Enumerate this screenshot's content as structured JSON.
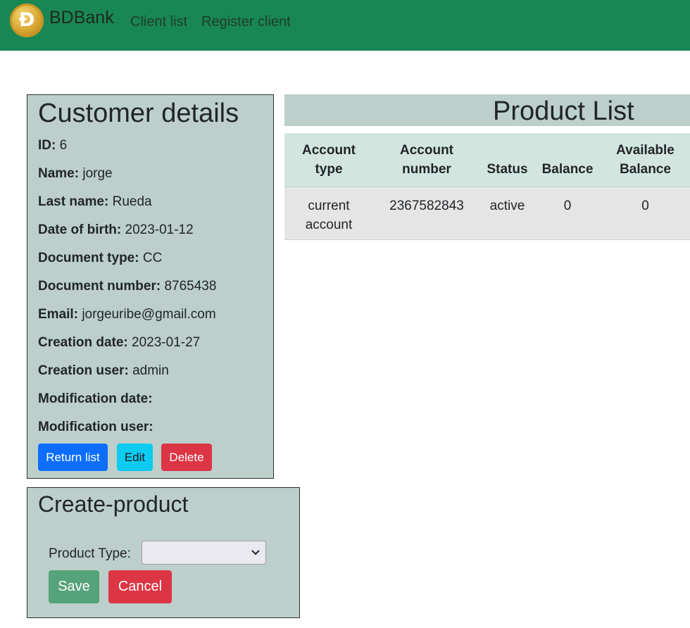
{
  "navbar": {
    "logo_glyph": "Đ",
    "brand": "BDBank",
    "links": [
      "Client list",
      "Register client"
    ],
    "bg_color": "#198754"
  },
  "customer_details": {
    "title": "Customer details",
    "fields": [
      {
        "label": "ID:",
        "value": "6"
      },
      {
        "label": "Name:",
        "value": "jorge"
      },
      {
        "label": "Last name:",
        "value": "Rueda"
      },
      {
        "label": "Date of birth:",
        "value": "2023-01-12"
      },
      {
        "label": "Document type:",
        "value": "CC"
      },
      {
        "label": "Document number:",
        "value": "8765438"
      },
      {
        "label": "Email:",
        "value": "jorgeuribe@gmail.com"
      },
      {
        "label": "Creation date:",
        "value": "2023-01-27"
      },
      {
        "label": "Creation user:",
        "value": "admin"
      },
      {
        "label": "Modification date:",
        "value": ""
      },
      {
        "label": "Modification user:",
        "value": ""
      }
    ],
    "buttons": {
      "return": "Return list",
      "edit": "Edit",
      "delete": "Delete"
    }
  },
  "create_product": {
    "title": "Create-product",
    "product_type_label": "Product Type:",
    "product_type_value": "",
    "save": "Save",
    "cancel": "Cancel"
  },
  "product_list": {
    "title": "Product List",
    "headers": [
      {
        "line1": "Account",
        "line2": "type"
      },
      {
        "line1": "Account",
        "line2": "number"
      },
      {
        "line1": "Status",
        "line2": ""
      },
      {
        "line1": "Balance",
        "line2": ""
      },
      {
        "line1": "Available",
        "line2": "Balance"
      }
    ],
    "rows": [
      {
        "account_type_1": "current",
        "account_type_2": "account",
        "account_number": "2367582843",
        "status": "active",
        "balance": "0",
        "available_balance": "0"
      }
    ]
  }
}
